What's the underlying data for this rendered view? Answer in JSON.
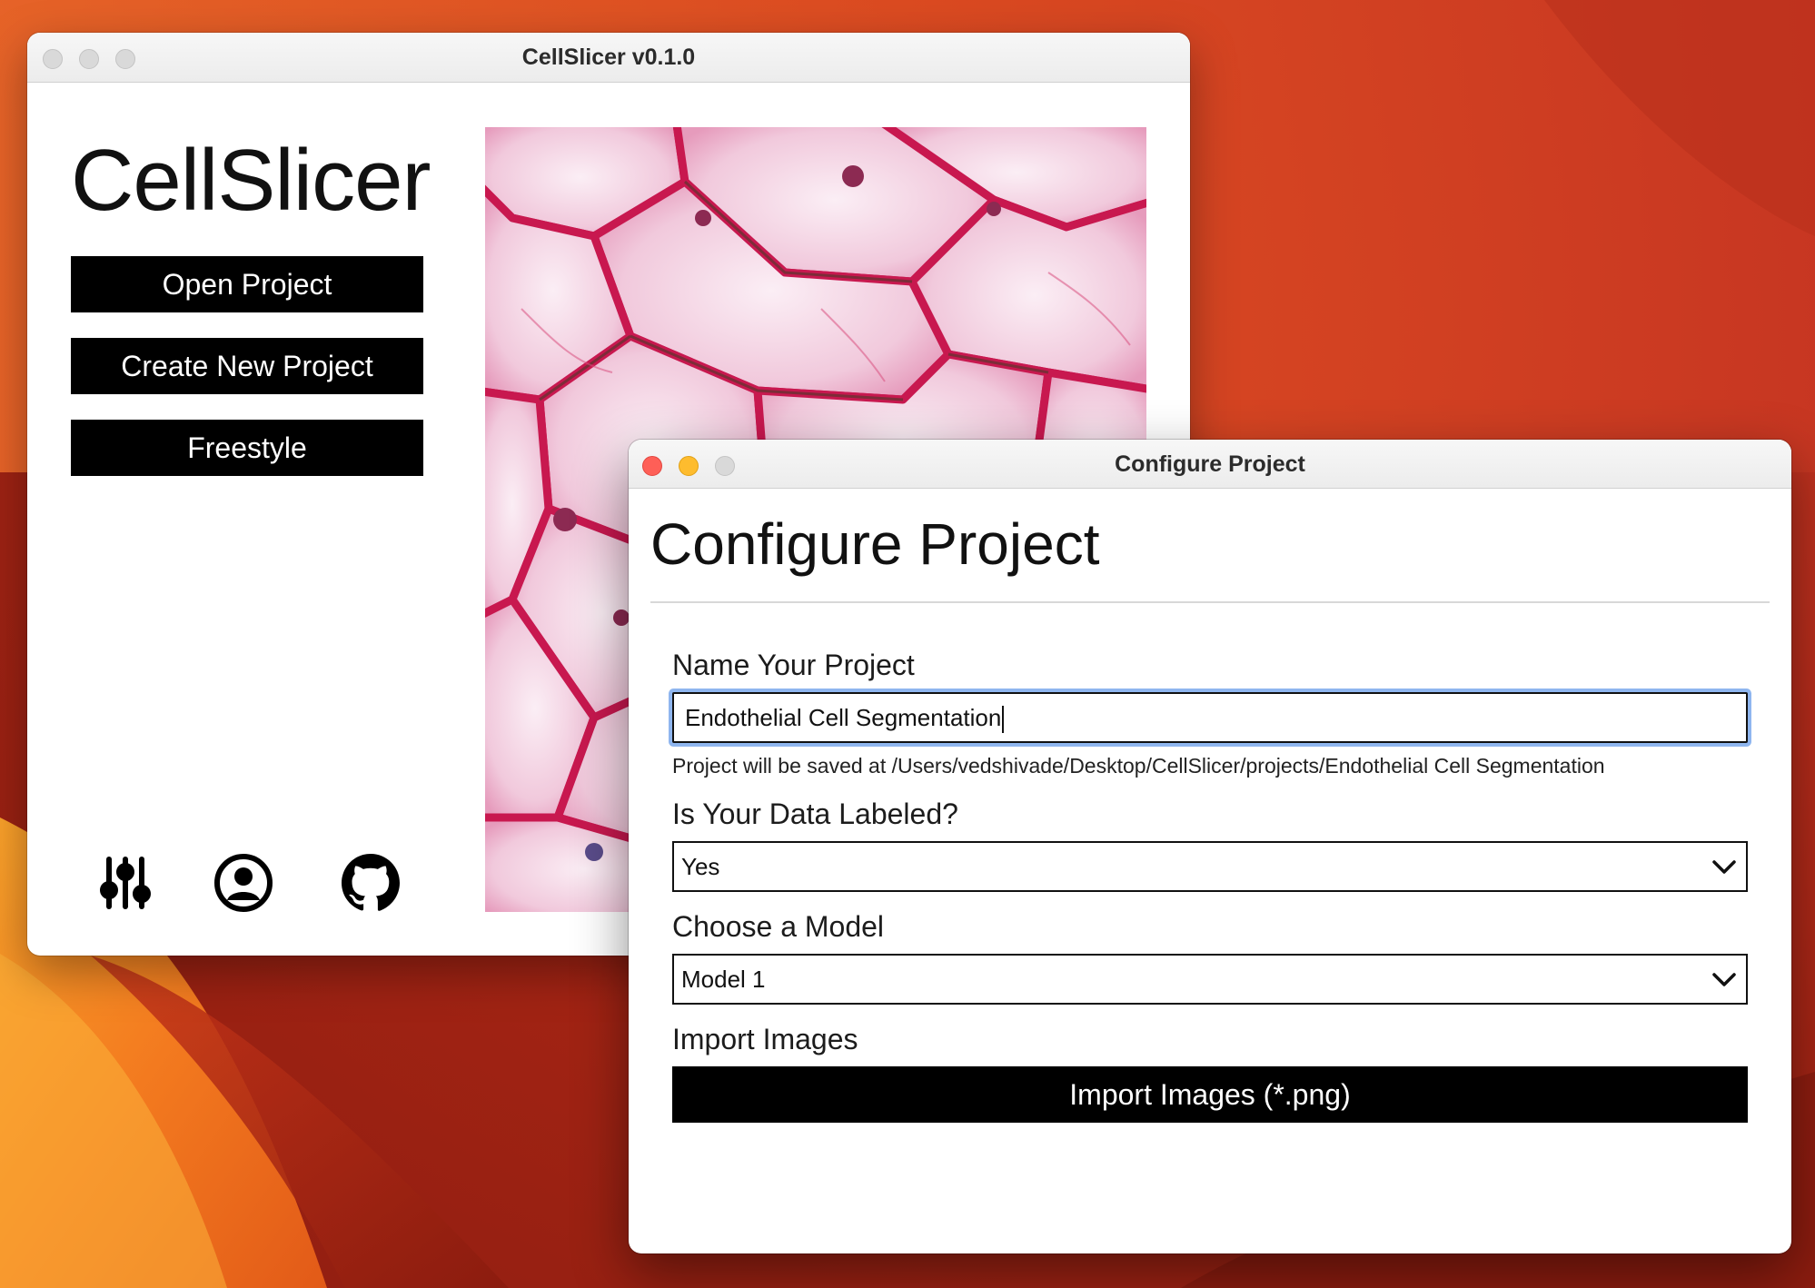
{
  "main_window": {
    "title": "CellSlicer v0.1.0",
    "app_title": "CellSlicer",
    "buttons": {
      "open_project": "Open Project",
      "create_project": "Create New Project",
      "freestyle": "Freestyle"
    },
    "icons": [
      "settings-sliders-icon",
      "account-icon",
      "github-icon"
    ]
  },
  "config_window": {
    "title": "Configure Project",
    "heading": "Configure Project",
    "name_label": "Name Your Project",
    "name_value": "Endothelial Cell Segmentation",
    "save_path_hint": "Project will be saved at /Users/vedshivade/Desktop/CellSlicer/projects/Endothelial Cell Segmentation",
    "labeled_label": "Is Your Data Labeled?",
    "labeled_value": "Yes",
    "model_label": "Choose a Model",
    "model_value": "Model 1",
    "import_label": "Import Images",
    "import_button": "Import Images (*.png)"
  },
  "colors": {
    "traffic_close": "#fe5f57",
    "traffic_minimize": "#febc2e",
    "input_focus": "#8fb6ef",
    "button_bg": "#000000"
  }
}
